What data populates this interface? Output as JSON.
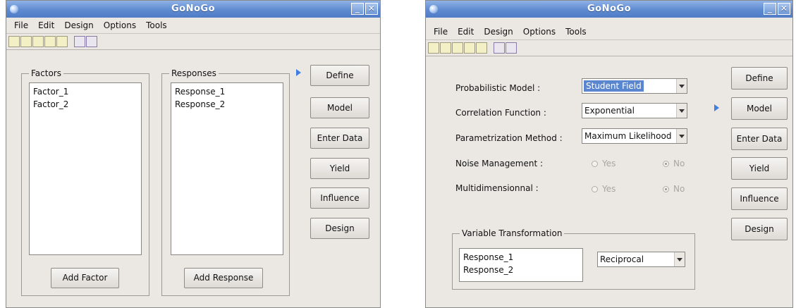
{
  "left_window": {
    "title": "GoNoGo",
    "menu": [
      "File",
      "Edit",
      "Design",
      "Options",
      "Tools"
    ],
    "factors": {
      "title": "Factors",
      "items": [
        "Factor_1",
        "Factor_2"
      ],
      "add_label": "Add Factor"
    },
    "responses": {
      "title": "Responses",
      "items": [
        "Response_1",
        "Response_2"
      ],
      "add_label": "Add Response"
    },
    "side_buttons": [
      "Define",
      "Model",
      "Enter Data",
      "Yield",
      "Influence",
      "Design"
    ],
    "active_step": "Define"
  },
  "right_window": {
    "title": "GoNoGo",
    "menu": [
      "File",
      "Edit",
      "Design",
      "Options",
      "Tools"
    ],
    "fields": {
      "prob_model": {
        "label": "Probabilistic Model :",
        "value": "Student Field"
      },
      "corr_function": {
        "label": "Correlation Function :",
        "value": "Exponential"
      },
      "param_method": {
        "label": "Parametrization Method :",
        "value": "Maximum Likelihood"
      },
      "noise": {
        "label": "Noise Management :",
        "yes": "Yes",
        "no": "No",
        "selected": "No"
      },
      "multidim": {
        "label": "Multidimensionnal :",
        "yes": "Yes",
        "no": "No",
        "selected": "No"
      }
    },
    "transformation": {
      "title": "Variable Transformation",
      "items": [
        "Response_1",
        "Response_2"
      ],
      "value": "Reciprocal"
    },
    "side_buttons": [
      "Define",
      "Model",
      "Enter Data",
      "Yield",
      "Influence",
      "Design"
    ],
    "active_step": "Model"
  },
  "colors": {
    "titlebar": "#5e8ad0",
    "window_bg": "#ebe8e4",
    "selection": "#5a86d0",
    "arrow": "#3f7fe0"
  }
}
